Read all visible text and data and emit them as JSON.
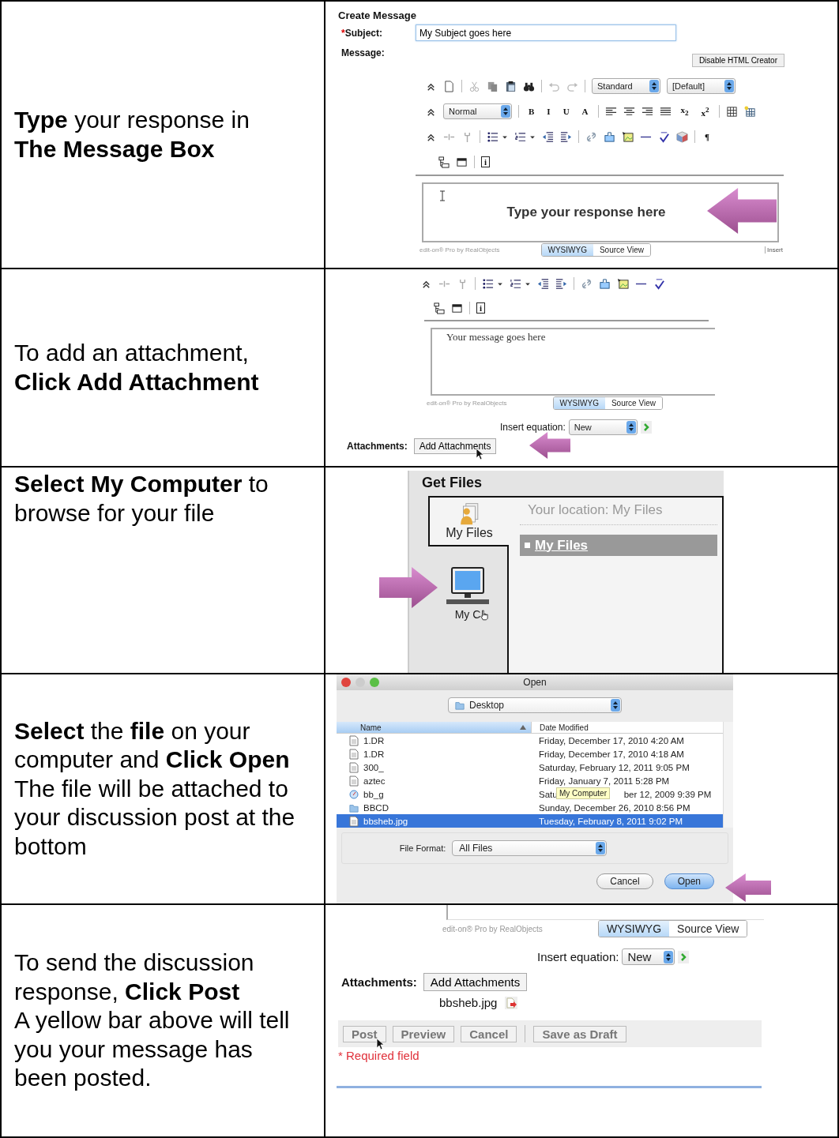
{
  "steps": [
    {
      "kind": "compose",
      "instruction": "**Type** your response in\n**The Message Box**",
      "panel": {
        "heading": "Create Message",
        "subject": {
          "required_mark": "*",
          "label": "Subject:",
          "value": "My Subject goes here"
        },
        "message_label": "Message:",
        "html_button": "Disable HTML Creator",
        "toolbars": [
          {
            "kind": "edit",
            "items": [
              {
                "kind": "icon"
              },
              {
                "kind": "icon"
              },
              {
                "kind": "separator"
              },
              {
                "kind": "icon"
              },
              {
                "kind": "icon"
              },
              {
                "kind": "icon"
              },
              {
                "kind": "icon"
              },
              {
                "kind": "separator"
              },
              {
                "kind": "icon"
              },
              {
                "kind": "icon"
              },
              {
                "kind": "separator"
              },
              {
                "kind": "select",
                "value": "Standard"
              },
              {
                "kind": "select",
                "value": "[Default]"
              }
            ]
          },
          {
            "kind": "format",
            "items": [
              {
                "kind": "icon"
              },
              {
                "kind": "select",
                "value": "Normal"
              },
              {
                "kind": "separator"
              },
              {
                "kind": "glyph",
                "text": "B"
              },
              {
                "kind": "glyph",
                "text": "I"
              },
              {
                "kind": "glyph",
                "text": "U"
              },
              {
                "kind": "glyph",
                "text": "A"
              },
              {
                "kind": "separator"
              },
              {
                "kind": "icon"
              },
              {
                "kind": "icon"
              },
              {
                "kind": "icon"
              },
              {
                "kind": "icon"
              },
              {
                "kind": "glyph",
                "text": "x$_{2}$"
              },
              {
                "kind": "glyph",
                "text": "x$^{2}$"
              },
              {
                "kind": "separator"
              },
              {
                "kind": "icon"
              },
              {
                "kind": "icon"
              }
            ]
          },
          {
            "kind": "insert",
            "items": [
              {
                "kind": "icon"
              },
              {
                "kind": "icon"
              },
              {
                "kind": "icon"
              },
              {
                "kind": "separator"
              },
              {
                "kind": "icon"
              },
              {
                "kind": "icon"
              },
              {
                "kind": "icon"
              },
              {
                "kind": "icon"
              },
              {
                "kind": "icon"
              },
              {
                "kind": "icon"
              },
              {
                "kind": "separator"
              },
              {
                "kind": "icon"
              },
              {
                "kind": "icon"
              },
              {
                "kind": "icon"
              },
              {
                "kind": "icon"
              },
              {
                "kind": "icon"
              },
              {
                "kind": "icon"
              },
              {
                "kind": "separator"
              },
              {
                "kind": "glyph",
                "text": "¶"
              }
            ]
          },
          {
            "kind": "misc",
            "items": [
              {
                "kind": "icon"
              },
              {
                "kind": "icon"
              },
              {
                "kind": "separator"
              },
              {
                "kind": "glyph",
                "text": "i"
              }
            ]
          }
        ],
        "editor_text": "Type your response here",
        "brand": "edit-on® Pro by RealObjects",
        "view_tabs": [
          {
            "label": "WYSIWYG",
            "selected": true
          },
          {
            "label": "Source View",
            "selected": false
          }
        ],
        "insert_label": "Insert"
      }
    },
    {
      "kind": "attach",
      "instruction": "To add an attachment,\n**Click Add Attachment**",
      "panel": {
        "toolbars": [
          {
            "kind": "insert",
            "items": [
              {
                "kind": "icon"
              },
              {
                "kind": "icon"
              },
              {
                "kind": "icon"
              },
              {
                "kind": "separator"
              },
              {
                "kind": "icon"
              },
              {
                "kind": "icon"
              },
              {
                "kind": "icon"
              },
              {
                "kind": "icon"
              },
              {
                "kind": "icon"
              },
              {
                "kind": "icon"
              },
              {
                "kind": "separator"
              },
              {
                "kind": "icon"
              },
              {
                "kind": "icon"
              },
              {
                "kind": "icon"
              },
              {
                "kind": "icon"
              },
              {
                "kind": "icon"
              }
            ]
          },
          {
            "kind": "misc",
            "items": [
              {
                "kind": "icon"
              },
              {
                "kind": "icon"
              },
              {
                "kind": "separator"
              },
              {
                "kind": "glyph",
                "text": "i"
              }
            ]
          }
        ],
        "editor_text": "Your message goes here",
        "brand": "edit-on® Pro by RealObjects",
        "view_tabs": [
          {
            "label": "WYSIWYG",
            "selected": true
          },
          {
            "label": "Source View",
            "selected": false
          }
        ],
        "equation_label": "Insert equation:",
        "equation_value": "New",
        "attachments_label": "Attachments:",
        "attach_button": "Add Attachments"
      }
    },
    {
      "kind": "files",
      "instruction": "**Select My Computer** to\nbrowse for your file",
      "panel": {
        "title": "Get Files",
        "sources": [
          {
            "label": "My Files",
            "selected": true
          },
          {
            "label": "My C",
            "selected": false
          }
        ],
        "location": "Your location: My Files",
        "folder": "My Files"
      }
    },
    {
      "kind": "open",
      "instruction": "**Select** the **file** on your\ncomputer and **Click Open**\nThe file will be attached to\nyour discussion post at the\nbottom",
      "panel": {
        "title": "Open",
        "location": "Desktop",
        "columns": [
          "Name",
          "Date Modified"
        ],
        "rows": [
          {
            "kind": "document",
            "name": "1.DR",
            "date": "Friday, December 17, 2010 4:20 AM",
            "selected": false
          },
          {
            "kind": "document",
            "name": "1.DR",
            "date": "Friday, December 17, 2010 4:18 AM",
            "selected": false
          },
          {
            "kind": "document",
            "name": "300_",
            "date": "Saturday, February 12, 2011 9:05 PM",
            "selected": false
          },
          {
            "kind": "document",
            "name": "aztec",
            "date": "Friday, January 7, 2011 5:28 PM",
            "selected": false
          },
          {
            "kind": "web",
            "name": "bb_g",
            "date": "Satu",
            "date_end": "ber 12, 2009 9:39 PM",
            "selected": false
          },
          {
            "kind": "folder",
            "name": "BBCD",
            "date": "Sunday, December 26, 2010 8:56 PM",
            "selected": false
          },
          {
            "kind": "document",
            "name": "bbsheb.jpg",
            "date": "Tuesday, February 8, 2011 9:02 PM",
            "selected": true
          }
        ],
        "tooltip": "My Computer",
        "format_label": "File Format:",
        "format_value": "All Files",
        "buttons": [
          {
            "label": "Cancel",
            "default": false
          },
          {
            "label": "Open",
            "default": true
          }
        ]
      }
    },
    {
      "kind": "post",
      "instruction": "To send the discussion\nresponse, **Click Post**\nA yellow bar above will tell\nyou your message has\nbeen posted.",
      "panel": {
        "brand": "edit-on® Pro by RealObjects",
        "view_tabs": [
          {
            "label": "WYSIWYG",
            "selected": true
          },
          {
            "label": "Source View",
            "selected": false
          }
        ],
        "equation_label": "Insert equation:",
        "equation_value": "New",
        "attachments_label": "Attachments:",
        "attach_button": "Add Attachments",
        "file": "bbsheb.jpg",
        "actions": [
          "Post",
          "Preview",
          "Cancel",
          "Save as Draft"
        ],
        "required_note": "* Required field"
      }
    }
  ]
}
